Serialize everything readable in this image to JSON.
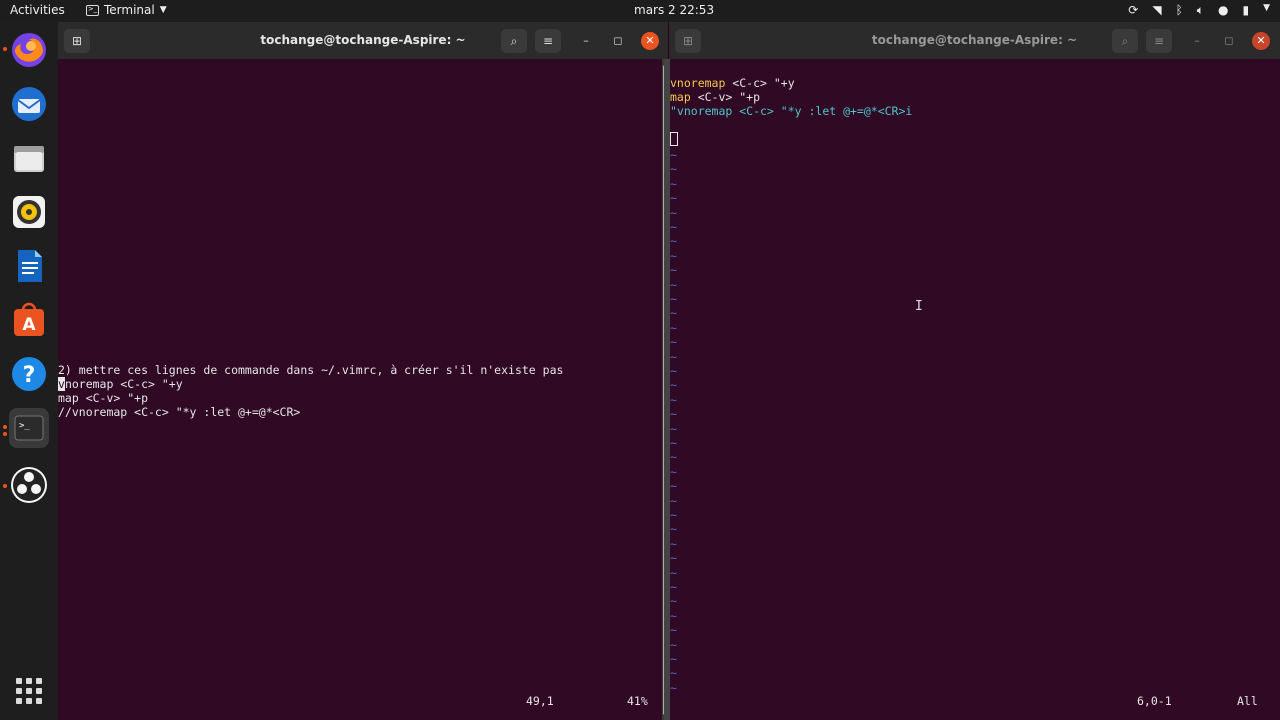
{
  "topbar": {
    "activities": "Activities",
    "app_name": "Terminal",
    "clock": "mars 2  22:53"
  },
  "dock": {
    "items": [
      "firefox-icon",
      "thunderbird-icon",
      "files-icon",
      "rhythmbox-icon",
      "libreoffice-writer-icon",
      "software-center-icon",
      "help-icon",
      "terminal-icon",
      "obs-icon"
    ]
  },
  "left_window": {
    "title": "tochange@tochange-Aspire: ~",
    "lines": [
      "2) mettre ces lignes de commande dans ~/.vimrc, à créer s'il n'existe pas",
      "noremap <C-c> \"+y",
      "map <C-v> \"+p",
      "//vnoremap <C-c> \"*y :let @+=@*<CR>"
    ],
    "cursor_char": "v",
    "status_pos": "49,1",
    "status_pct": "41%"
  },
  "right_window": {
    "title": "tochange@tochange-Aspire: ~",
    "lines": [
      {
        "kw": "vnoremap",
        "rest": " <C-c> \"+y"
      },
      {
        "kw": "map",
        "rest": " <C-v> \"+p"
      },
      {
        "comment": "\"vnoremap <C-c> \"*y :let @+=@*<CR>i"
      }
    ],
    "tilde": "~",
    "status_pos": "6,0-1",
    "status_pct": "All"
  },
  "colors": {
    "terminal_bg": "#300a24",
    "keyword": "#f0c94e",
    "comment": "#4fc3c8",
    "tilde": "#5c6bc0",
    "accent": "#e95420"
  }
}
